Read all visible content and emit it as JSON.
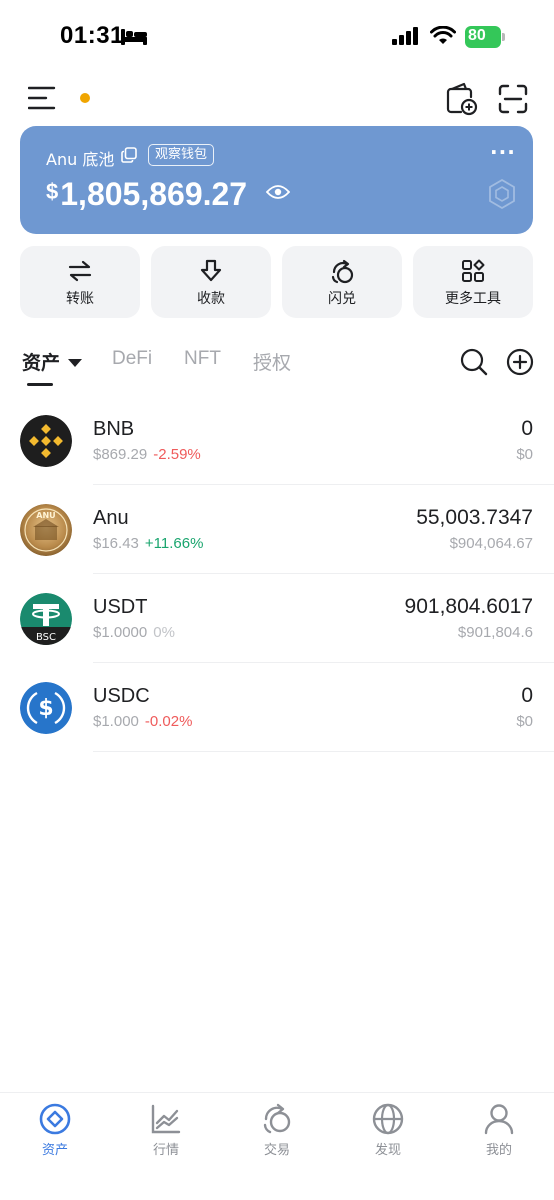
{
  "status_bar": {
    "time": "01:31",
    "battery": "80"
  },
  "wallet": {
    "name": "Anu 底池",
    "watch_badge": "观察钱包",
    "more": "···",
    "currency_symbol": "$",
    "balance": "1,805,869.27"
  },
  "actions": [
    {
      "label": "转账",
      "icon": "transfer-icon"
    },
    {
      "label": "收款",
      "icon": "receive-icon"
    },
    {
      "label": "闪兑",
      "icon": "swap-icon"
    },
    {
      "label": "更多工具",
      "icon": "grid-icon"
    }
  ],
  "tabs": [
    {
      "label": "资产",
      "active": true
    },
    {
      "label": "DeFi",
      "active": false
    },
    {
      "label": "NFT",
      "active": false
    },
    {
      "label": "授权",
      "active": false
    }
  ],
  "tokens": [
    {
      "symbol": "BNB",
      "price": "$869.29",
      "change": "-2.59%",
      "trend": "down",
      "amount": "0",
      "value": "$0"
    },
    {
      "symbol": "Anu",
      "price": "$16.43",
      "change": "+11.66%",
      "trend": "up",
      "amount": "55,003.7347",
      "value": "$904,064.67"
    },
    {
      "symbol": "USDT",
      "price": "$1.0000",
      "change": "0%",
      "trend": "flat",
      "amount": "901,804.6017",
      "value": "$901,804.6"
    },
    {
      "symbol": "USDC",
      "price": "$1.000",
      "change": "-0.02%",
      "trend": "down",
      "amount": "0",
      "value": "$0"
    }
  ],
  "token_logo_text": {
    "anu": "ANU",
    "usdt_network": "BSC"
  },
  "bottom_nav": [
    {
      "label": "资产",
      "active": true
    },
    {
      "label": "行情",
      "active": false
    },
    {
      "label": "交易",
      "active": false
    },
    {
      "label": "发现",
      "active": false
    },
    {
      "label": "我的",
      "active": false
    }
  ],
  "colors": {
    "card": "#6f98d1",
    "accent": "#3b7ae0",
    "down": "#ef5b5b",
    "up": "#1aa56e",
    "bnb": "#f3ba2f",
    "usdt": "#1a8a6e",
    "usdc": "#2775ca",
    "dot": "#f0a500"
  }
}
